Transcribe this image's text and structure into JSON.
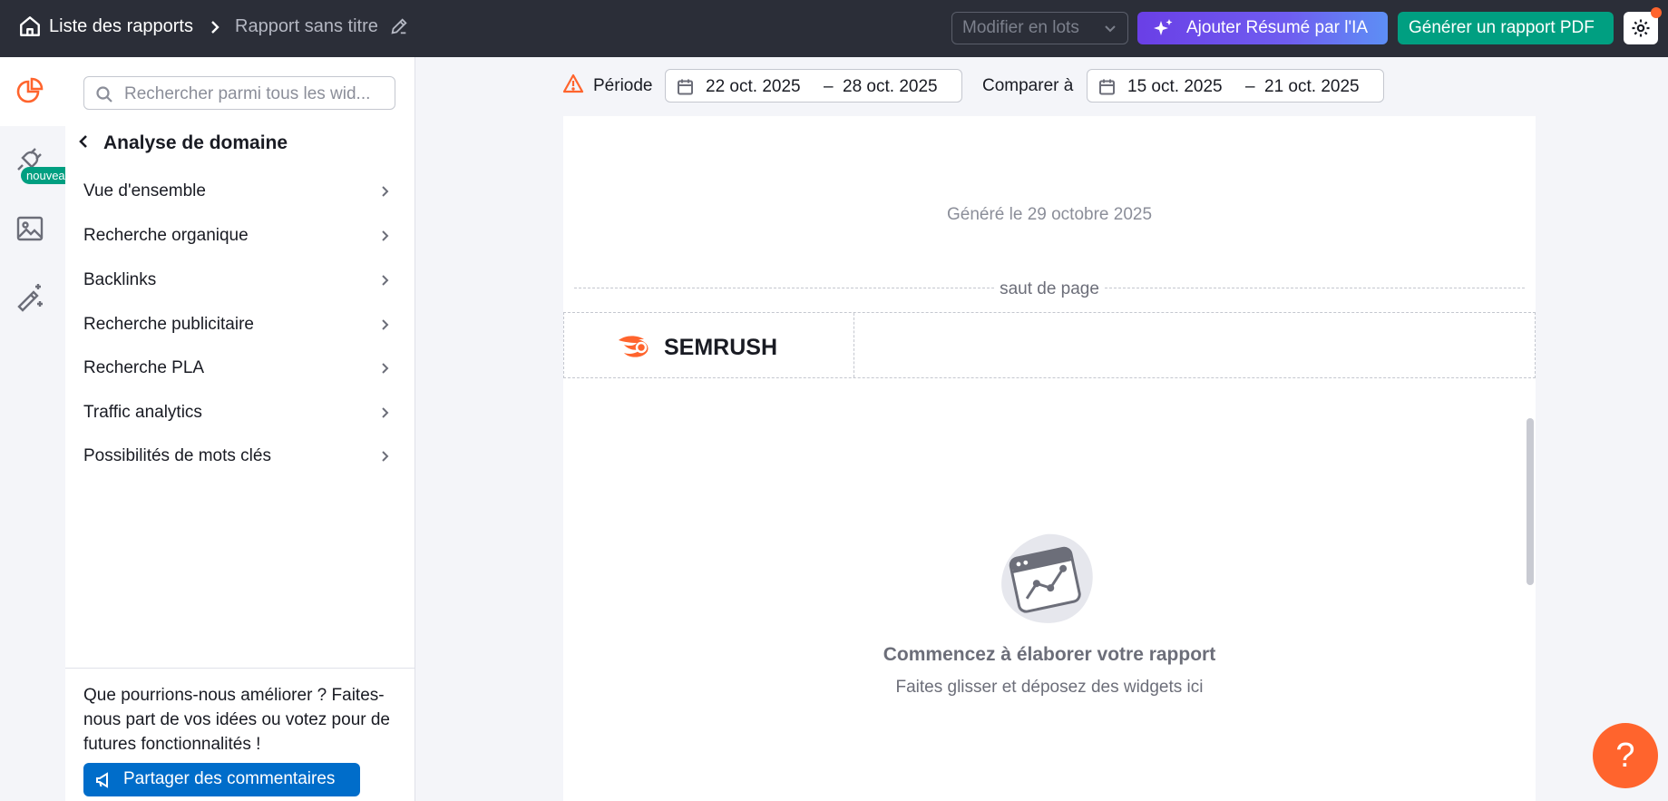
{
  "topbar": {
    "breadcrumb_root": "Liste des rapports",
    "report_title": "Rapport sans titre",
    "bulk_edit_label": "Modifier en lots",
    "ai_summary_label": "Ajouter Résumé par l'IA",
    "pdf_label": "Générer un rapport PDF"
  },
  "rail": {
    "new_badge": "nouveau"
  },
  "sidebar": {
    "search_placeholder": "Rechercher parmi tous les wid...",
    "section_title": "Analyse de domaine",
    "items": [
      {
        "label": "Vue d'ensemble"
      },
      {
        "label": "Recherche organique"
      },
      {
        "label": "Backlinks"
      },
      {
        "label": "Recherche publicitaire"
      },
      {
        "label": "Recherche PLA"
      },
      {
        "label": "Traffic analytics"
      },
      {
        "label": "Possibilités de mots clés"
      }
    ],
    "feedback_text": "Que pourrions-nous améliorer ? Faites-nous part de vos idées ou votez pour de futures fonctionnalités !",
    "feedback_button": "Partager des commentaires"
  },
  "period": {
    "label": "Période",
    "start": "22 oct. 2025",
    "end": "28 oct. 2025",
    "compare_label": "Comparer à",
    "compare_start": "15 oct. 2025",
    "compare_end": "21 oct. 2025",
    "dash": "–"
  },
  "report": {
    "generated": "Généré le 29 octobre 2025",
    "page_break": "saut de page",
    "empty_title": "Commencez à élaborer votre rapport",
    "empty_subtitle": "Faites glisser et déposez des widgets ici"
  },
  "help": {
    "label": "?"
  },
  "colors": {
    "topbar": "#2b2e38",
    "accent_orange": "#ff642d",
    "green": "#009f81",
    "blue": "#006dca",
    "purple": "#6a3fe6"
  }
}
